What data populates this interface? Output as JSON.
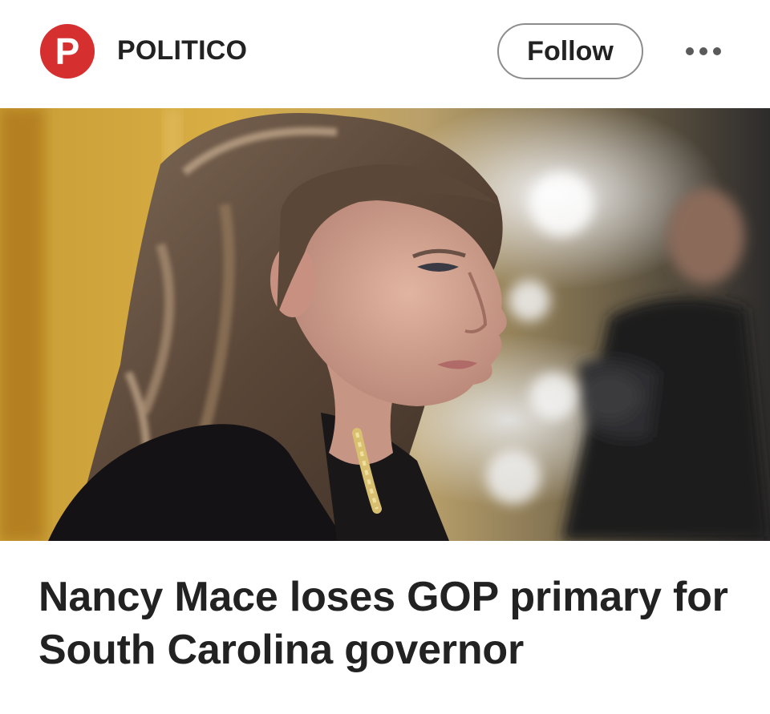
{
  "header": {
    "logo_letter": "P",
    "source_name": "POLITICO",
    "follow_label": "Follow",
    "more_icon": "more-horizontal-icon"
  },
  "article": {
    "image_icon": "article-photo",
    "headline": "Nancy Mace loses GOP primary for South Carolina governor"
  },
  "colors": {
    "brand": "#d62f2f",
    "text": "#222222"
  }
}
